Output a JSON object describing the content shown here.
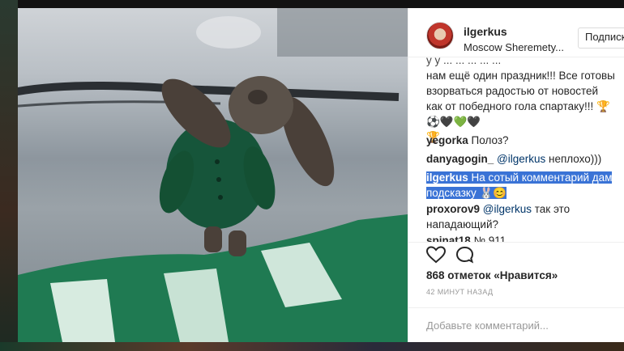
{
  "post": {
    "username": "ilgerkus",
    "location": "Moscow Sheremety...",
    "follow_label": "Подписк",
    "photo_icon": "teddy-bear-photo"
  },
  "comments": {
    "caption_partial": "нам ещё один праздник!!! Все готовы взорваться радостью от новостей как от победного гола спартаку!!! 🏆⚽🖤💚🖤",
    "caption_trailing": "🏆",
    "items": [
      {
        "user": "yegorka",
        "text": " Полоз?"
      },
      {
        "user": "danyagogin_",
        "mention": " @ilgerkus",
        "text": " неплохо)))"
      },
      {
        "user": "ilgerkus",
        "text": " На сотый комментарий дам подсказку 🐰😊"
      },
      {
        "user": "proxorov9",
        "mention": " @ilgerkus",
        "text": " так это нападающий?"
      },
      {
        "user": "spinat18",
        "text": " № 911"
      }
    ]
  },
  "actions": {
    "likes_label": "868 отметок «Нравится»",
    "time_label": "42 МИНУТ НАЗАД",
    "add_comment_placeholder": "Добавьте комментарий..."
  },
  "colors": {
    "selection": "#3a73d6",
    "mention": "#003569",
    "jersey_green": "#1f7a52"
  }
}
